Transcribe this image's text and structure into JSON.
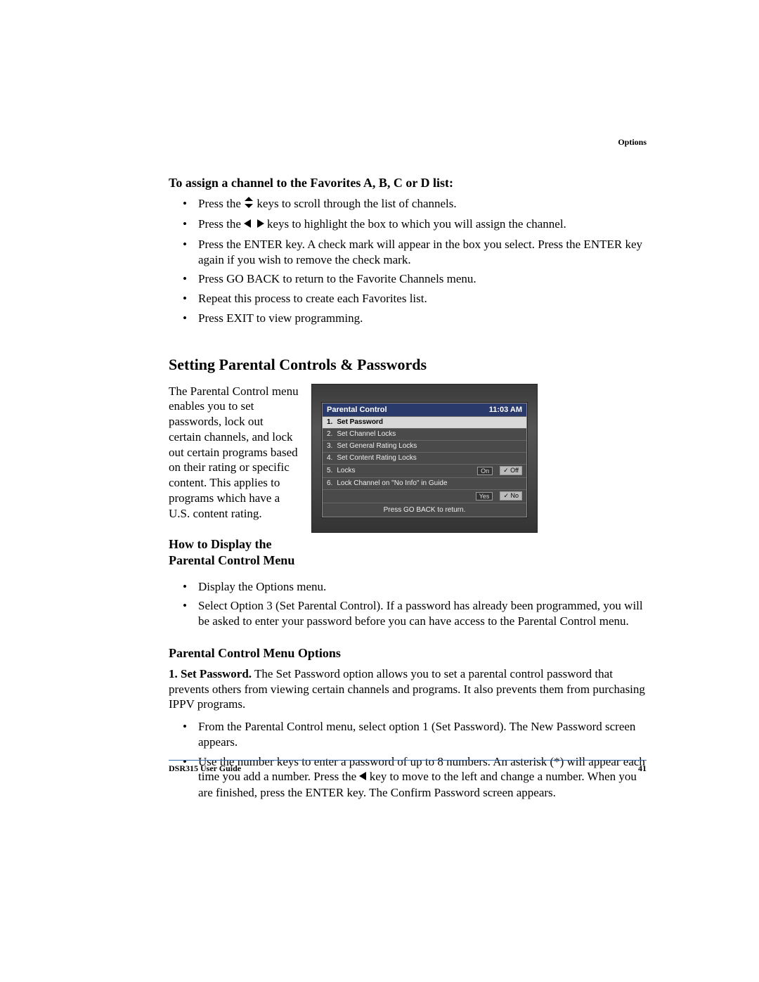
{
  "header": {
    "section": "Options"
  },
  "favorites": {
    "heading": "To assign a channel to the Favorites A, B, C or D list:",
    "items": [
      {
        "pre": "Press the ",
        "icon": "updown",
        "post": " keys to scroll through the list of channels."
      },
      {
        "pre": "Press the ",
        "icon": "leftright",
        "post": " keys to highlight the box to which you will assign the channel."
      },
      {
        "text": "Press the ENTER key. A check mark will appear in the box you select. Press the ENTER key again if you wish to remove the check mark."
      },
      {
        "text": "Press GO BACK to return to the Favorite Channels menu."
      },
      {
        "text": "Repeat this process to create each Favorites list."
      },
      {
        "text": "Press EXIT to view programming."
      }
    ]
  },
  "parental": {
    "title": "Setting Parental Controls & Passwords",
    "intro": "The Parental Control menu enables you to set passwords, lock out certain channels, and lock out certain programs based on their rating or specific content. This applies to programs which have a U.S. content rating.",
    "menu": {
      "title": "Parental Control",
      "time": "11:03 AM",
      "rows": [
        {
          "n": "1.",
          "label": "Set Password",
          "hl": true
        },
        {
          "n": "2.",
          "label": "Set Channel Locks"
        },
        {
          "n": "3.",
          "label": "Set General Rating Locks"
        },
        {
          "n": "4.",
          "label": "Set Content Rating Locks"
        },
        {
          "n": "5.",
          "label": "Locks",
          "opts": [
            "On",
            "Off"
          ],
          "sel": 1
        },
        {
          "n": "6.",
          "label": "Lock Channel on \"No Info\" in Guide"
        },
        {
          "n": "",
          "label": "",
          "opts": [
            "Yes",
            "No"
          ],
          "sel": 1
        }
      ],
      "footer": "Press GO BACK to return."
    },
    "howto": {
      "heading": "How to Display the Parental Control Menu",
      "items": [
        "Display the Options menu.",
        "Select Option 3 (Set Parental Control). If a password has already been programmed, you will be asked to enter your password before you can have access to the Parental Control menu."
      ]
    },
    "options": {
      "heading": "Parental Control Menu Options",
      "lead_bold": "1. Set Password.",
      "lead_rest": " The Set Password option allows you to set a parental control password that prevents others from viewing certain channels and programs. It also prevents them from purchasing IPPV programs.",
      "items": [
        {
          "text": "From the Parental Control menu, select option 1 (Set Password). The New Password screen appears."
        },
        {
          "pre": "Use the number keys to enter a password of up to 8 numbers. An asterisk (*) will appear each time you add a number. Press the ",
          "icon": "left",
          "post": " key to move to the left and change a number. When you are finished, press the ENTER key. The Confirm Password screen appears."
        }
      ]
    }
  },
  "footer": {
    "left": "DSR315 User Guide",
    "right": "41"
  }
}
